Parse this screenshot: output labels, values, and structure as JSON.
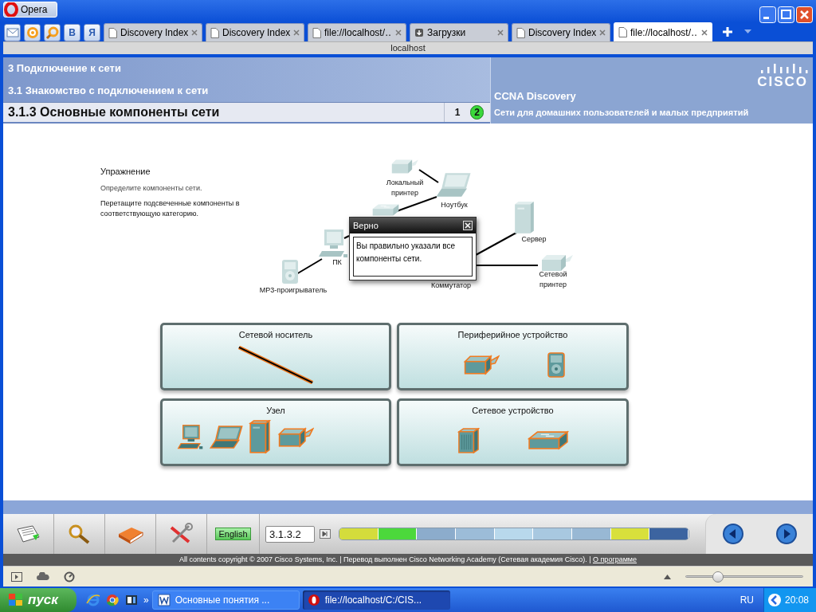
{
  "browser": {
    "title": "Opera",
    "quick_buttons": [
      {
        "kind": "mail"
      },
      {
        "kind": "at"
      },
      {
        "kind": "search"
      },
      {
        "kind": "letter",
        "label": "В"
      },
      {
        "kind": "letter",
        "label": "Я"
      }
    ],
    "tabs": [
      {
        "label": "Discovery Index",
        "kind": "page",
        "selected": false
      },
      {
        "label": "Discovery Index",
        "kind": "page",
        "selected": false
      },
      {
        "label": "file://localhost/…",
        "kind": "page",
        "selected": false
      },
      {
        "label": "Загрузки",
        "kind": "downloads",
        "selected": false
      },
      {
        "label": "Discovery Index",
        "kind": "page",
        "selected": false
      },
      {
        "label": "file://localhost/…",
        "kind": "page",
        "selected": true
      }
    ],
    "address": "localhost"
  },
  "header": {
    "chapter": "3 Подключение к сети",
    "section": "3.1 Знакомство с подключением к сети",
    "topic": "3.1.3 Основные компоненты сети",
    "pages": [
      {
        "label": "1",
        "selected": false
      },
      {
        "label": "2",
        "selected": true
      }
    ],
    "course": "CCNA Discovery",
    "subtitle": "Сети для домашних пользователей и малых предприятий",
    "logo": "CISCO"
  },
  "exercise": {
    "heading": "Упражнение",
    "task": "Определите компоненты сети.",
    "instruction": "Перетащите подсвеченные компоненты в соответствующую категорию."
  },
  "diagram": {
    "nodes": [
      {
        "kind": "printer",
        "label": "Локальный принтер"
      },
      {
        "kind": "laptop",
        "label": "Ноутбук"
      },
      {
        "kind": "server",
        "label": "Сервер"
      },
      {
        "kind": "printer",
        "label": "Сетевой принтер"
      },
      {
        "kind": "pc",
        "label": "ПК"
      },
      {
        "kind": "mp3",
        "label": "MP3-проигрыватель"
      },
      {
        "kind": "switch",
        "label": "Коммутатор"
      }
    ]
  },
  "feedback": {
    "title": "Верно",
    "message": "Вы правильно указали все компоненты сети."
  },
  "categories": [
    {
      "title": "Сетевой носитель",
      "items": [
        {
          "kind": "cable"
        }
      ]
    },
    {
      "title": "Периферийное устройство",
      "items": [
        {
          "kind": "printer"
        },
        {
          "kind": "mp3"
        }
      ]
    },
    {
      "title": "Узел",
      "items": [
        {
          "kind": "pc"
        },
        {
          "kind": "laptop"
        },
        {
          "kind": "server"
        },
        {
          "kind": "printer"
        }
      ]
    },
    {
      "title": "Сетевое устройство",
      "items": [
        {
          "kind": "router"
        },
        {
          "kind": "switch"
        }
      ]
    }
  ],
  "toolbar": {
    "buttons": [
      {
        "kind": "notes"
      },
      {
        "kind": "search"
      },
      {
        "kind": "book"
      },
      {
        "kind": "tools"
      }
    ],
    "language": "English",
    "page_field": "3.1.3.2",
    "progress": [
      {
        "color": "#d4dc3c"
      },
      {
        "color": "#4cd83c"
      },
      {
        "color": "#8caccc"
      },
      {
        "color": "#9cbcd8"
      },
      {
        "color": "#b8d8ec"
      },
      {
        "color": "#a8c8e0"
      },
      {
        "color": "#98b8d4"
      },
      {
        "color": "#d8e03c"
      },
      {
        "color": "#3c64a0"
      }
    ]
  },
  "footer": {
    "copyright": "All contents copyright © 2007 Cisco Systems, Inc. | Перевод выполнен Cisco Networking Academy (Сетевая академия Cisco). |",
    "link": "О программе"
  },
  "status_bar": {
    "zoom": {
      "level": 0.28
    }
  },
  "taskbar": {
    "start": "пуск",
    "quick_launch": [
      {
        "kind": "ie"
      },
      {
        "kind": "chrome"
      },
      {
        "kind": "media"
      }
    ],
    "overflow": "»",
    "tasks": [
      {
        "kind": "word",
        "label": "Основные понятия ...",
        "selected": false
      },
      {
        "kind": "opera",
        "label": "file://localhost/C:/CIS...",
        "selected": true
      }
    ],
    "language": "RU",
    "clock": "20:08"
  }
}
